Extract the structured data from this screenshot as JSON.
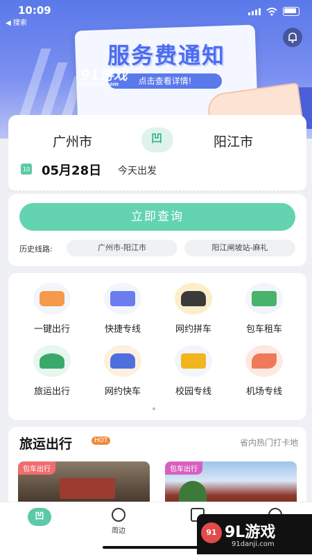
{
  "status_bar": {
    "time": "10:09",
    "back_label": "◀ 搜索"
  },
  "banner": {
    "title": "服务费通知",
    "link_text": "点击查看详情!",
    "watermark": "91游戏",
    "watermark_url": "91danji.com"
  },
  "route": {
    "from_city": "广州市",
    "to_city": "阳江市",
    "swap_glyph": "凹",
    "calendar_label": "10",
    "date": "05月28日",
    "depart_text": "今天出发"
  },
  "query": {
    "button": "立即查询",
    "history_label": "历史线路:",
    "history_routes": [
      "广州市-阳江市",
      "阳江闸坡站-麻礼"
    ]
  },
  "services": [
    {
      "label": "一键出行",
      "icon": "map-icon",
      "color": "#f59a4a"
    },
    {
      "label": "快捷专线",
      "icon": "bus-icon",
      "color": "#6b7cf0"
    },
    {
      "label": "网约拼车",
      "icon": "carpool-icon",
      "color": "#3a3a3a"
    },
    {
      "label": "包车租车",
      "icon": "charter-bus-icon",
      "color": "#49b36b"
    },
    {
      "label": "旅运出行",
      "icon": "palm-tree-icon",
      "color": "#3aa86a"
    },
    {
      "label": "网约快车",
      "icon": "express-car-icon",
      "color": "#4f6fe0"
    },
    {
      "label": "校园专线",
      "icon": "school-bus-icon",
      "color": "#f2b51f"
    },
    {
      "label": "机场专线",
      "icon": "airplane-icon",
      "color": "#ef7a5a"
    }
  ],
  "travel": {
    "title": "旅运出行",
    "hot_badge": "HOT",
    "subtitle": "省内热门打卡地",
    "cards": [
      {
        "tag": "包车出行"
      },
      {
        "tag": "包车出行"
      }
    ]
  },
  "bottom_nav": {
    "home_glyph": "凹",
    "items": [
      {
        "label": ""
      },
      {
        "label": "周边"
      },
      {
        "label": ""
      },
      {
        "label": ""
      }
    ]
  },
  "watermark_footer": {
    "brand": "9L游戏",
    "url": "91danji.com",
    "logo_text": "91"
  },
  "colors": {
    "accent": "#63d3b0",
    "hero": "#5a79ea",
    "hot": "#f08a3c",
    "tag": "#ef6d6d"
  }
}
